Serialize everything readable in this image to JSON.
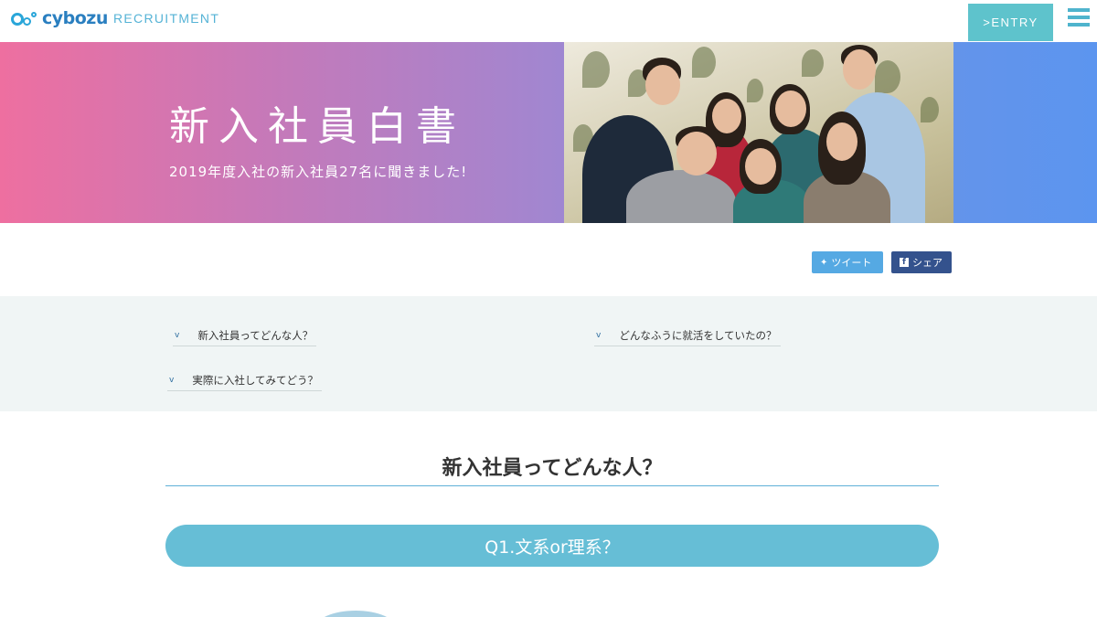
{
  "header": {
    "logo_text": "cybozu",
    "recruitment_label": "RECRUITMENT",
    "entry_label": ">ENTRY"
  },
  "hero": {
    "title": "新入社員白書",
    "subtitle": "2019年度入社の新入社員27名に聞きました!"
  },
  "share": {
    "tweet_label": "ツイート",
    "share_label": "シェア"
  },
  "toc": {
    "items": [
      {
        "marker": "v",
        "label": "新入社員ってどんな人？"
      },
      {
        "marker": "v",
        "label": "どんなふうに就活をしていたの？"
      },
      {
        "marker": "v",
        "label": "実際に入社してみてどう？"
      }
    ]
  },
  "section": {
    "title": "新入社員ってどんな人？",
    "question": "Q1.文系or理系？"
  },
  "colors": {
    "accent": "#5ec3cc",
    "brand": "#2a7fc0",
    "question_bar": "#66bed6",
    "twitter": "#55a9e3",
    "facebook": "#34528d"
  },
  "icons": [
    "menu-icon",
    "twitter-icon",
    "facebook-icon",
    "chevron-down-icon"
  ]
}
